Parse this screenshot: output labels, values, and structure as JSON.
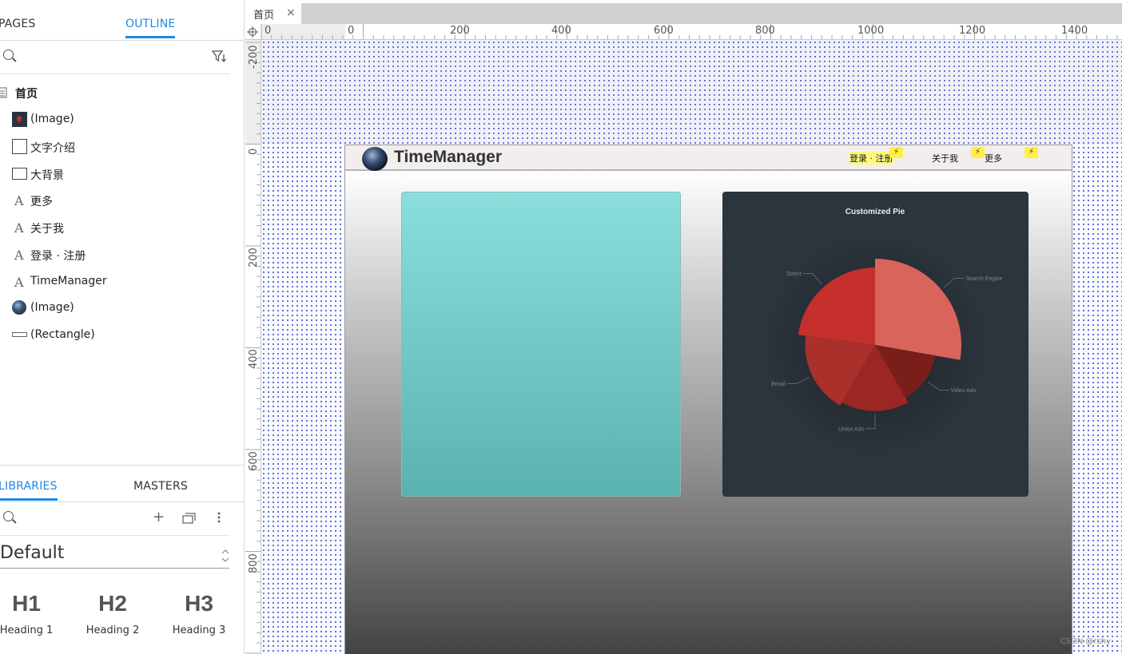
{
  "left_panel": {
    "tabs": [
      "PAGES",
      "OUTLINE"
    ],
    "outline": [
      {
        "label": "首页",
        "icon": "page-icon"
      },
      {
        "label": "(Image)",
        "icon": "image-thumb-icon"
      },
      {
        "label": "文字介绍",
        "icon": "box-icon"
      },
      {
        "label": "大背景",
        "icon": "box-wide-icon"
      },
      {
        "label": "更多",
        "icon": "text-icon"
      },
      {
        "label": "关于我",
        "icon": "text-icon"
      },
      {
        "label": "登录 · 注册",
        "icon": "text-icon"
      },
      {
        "label": "TimeManager",
        "icon": "text-icon"
      },
      {
        "label": "(Image)",
        "icon": "globe-thumb-icon"
      },
      {
        "label": "(Rectangle)",
        "icon": "rectangle-icon"
      }
    ],
    "library_tabs": [
      "LIBRARIES",
      "MASTERS"
    ],
    "library_name": "Default",
    "widgets": [
      {
        "big": "H1",
        "label": "Heading 1"
      },
      {
        "big": "H2",
        "label": "Heading 2"
      },
      {
        "big": "H3",
        "label": "Heading 3"
      }
    ]
  },
  "document": {
    "tab_label": "首页",
    "ruler_h": [
      "0",
      "0",
      "200",
      "400",
      "600",
      "800",
      "1000",
      "1200",
      "1400"
    ],
    "ruler_v": [
      "-200",
      "0",
      "200",
      "400",
      "600",
      "800"
    ]
  },
  "page_content": {
    "brand": "TimeManager",
    "nav": {
      "login": "登录 · 注册",
      "about": "关于我",
      "more": "更多"
    },
    "bolt": "⚡"
  },
  "chart_data": {
    "type": "pie",
    "title": "Customized Pie",
    "style": "rose",
    "series": [
      {
        "name": "Search Engine",
        "value": 400,
        "color": "#d9645c"
      },
      {
        "name": "Video Ads",
        "value": 200,
        "color": "#7a1e1b"
      },
      {
        "name": "Union Ads",
        "value": 240,
        "color": "#9c2623"
      },
      {
        "name": "Email",
        "value": 270,
        "color": "#aa302b"
      },
      {
        "name": "Direct",
        "value": 330,
        "color": "#c5302c"
      }
    ]
  },
  "watermark": "CSDN @rshy"
}
